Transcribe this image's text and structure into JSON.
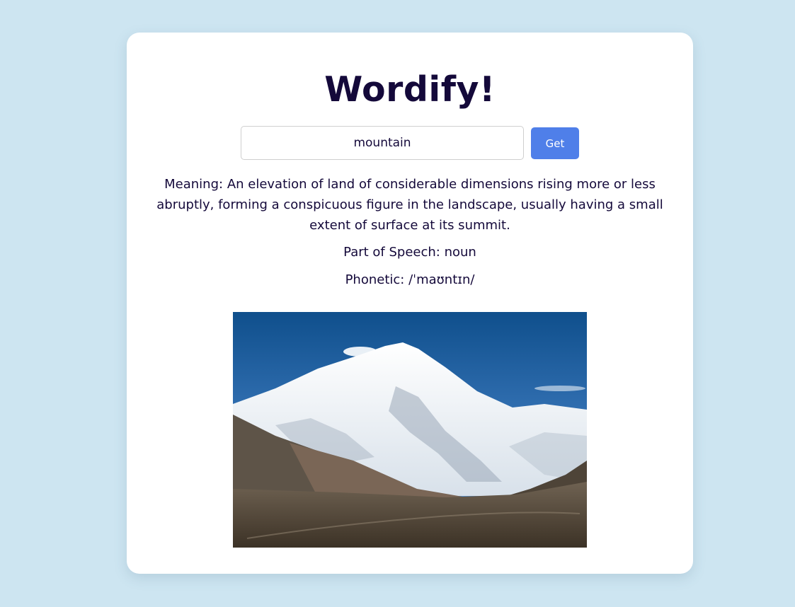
{
  "app": {
    "title": "Wordify!"
  },
  "search": {
    "value": "mountain",
    "button_label": "Get"
  },
  "result": {
    "meaning_label": "Meaning:",
    "meaning": "An elevation of land of considerable dimensions rising more or less abruptly, forming a conspicuous figure in the landscape, usually having a small extent of surface at its summit.",
    "part_of_speech_label": "Part of Speech:",
    "part_of_speech": "noun",
    "phonetic_label": "Phonetic:",
    "phonetic": "/ˈmaʊntɪn/"
  },
  "colors": {
    "page_background": "#cde5f1",
    "card_background": "#ffffff",
    "text": "#14093a",
    "accent": "#4f7fe9"
  }
}
